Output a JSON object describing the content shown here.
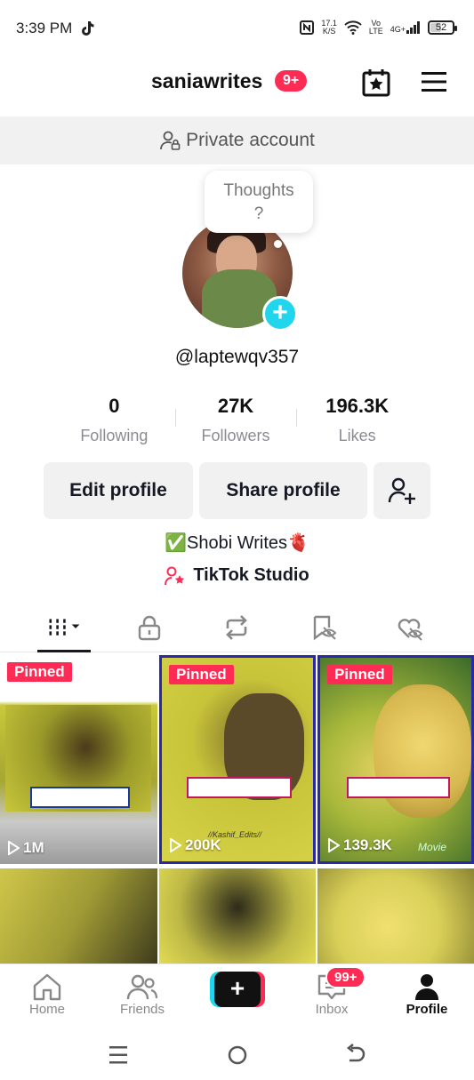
{
  "status_bar": {
    "time": "3:39 PM",
    "net_speed_value": "17.1",
    "net_speed_unit": "K/S",
    "volte_top": "Vo",
    "volte_bottom": "LTE",
    "network": "4G+",
    "battery": "52",
    "battery_level": 0.52
  },
  "header": {
    "username": "saniawrites",
    "notification_badge": "9+"
  },
  "private_banner": {
    "text": "Private account"
  },
  "thought_bubble": {
    "line1": "Thoughts",
    "line2": "?"
  },
  "profile": {
    "handle": "@laptewqv357",
    "stats": [
      {
        "value": "0",
        "label": "Following"
      },
      {
        "value": "27K",
        "label": "Followers"
      },
      {
        "value": "196.3K",
        "label": "Likes"
      }
    ],
    "bio": "✅Shobi Writes🫀",
    "studio_label": "TikTok Studio"
  },
  "buttons": {
    "edit": "Edit profile",
    "share": "Share profile"
  },
  "tabs": [
    "videos-icon",
    "lock-icon",
    "repost-icon",
    "bookmark-icon",
    "liked-icon"
  ],
  "videos": [
    {
      "pinned_label": "Pinned",
      "views": "1M"
    },
    {
      "pinned_label": "Pinned",
      "views": "200K",
      "watermark": "//Kashif_Edits//"
    },
    {
      "pinned_label": "Pinned",
      "views": "139.3K",
      "watermark": "Movie"
    }
  ],
  "bottom_nav": {
    "home": "Home",
    "friends": "Friends",
    "inbox": "Inbox",
    "inbox_badge": "99+",
    "profile": "Profile"
  },
  "colors": {
    "accent": "#fe2c55",
    "cyan": "#20d5ec",
    "text": "#161823",
    "muted": "#8a8b91"
  }
}
